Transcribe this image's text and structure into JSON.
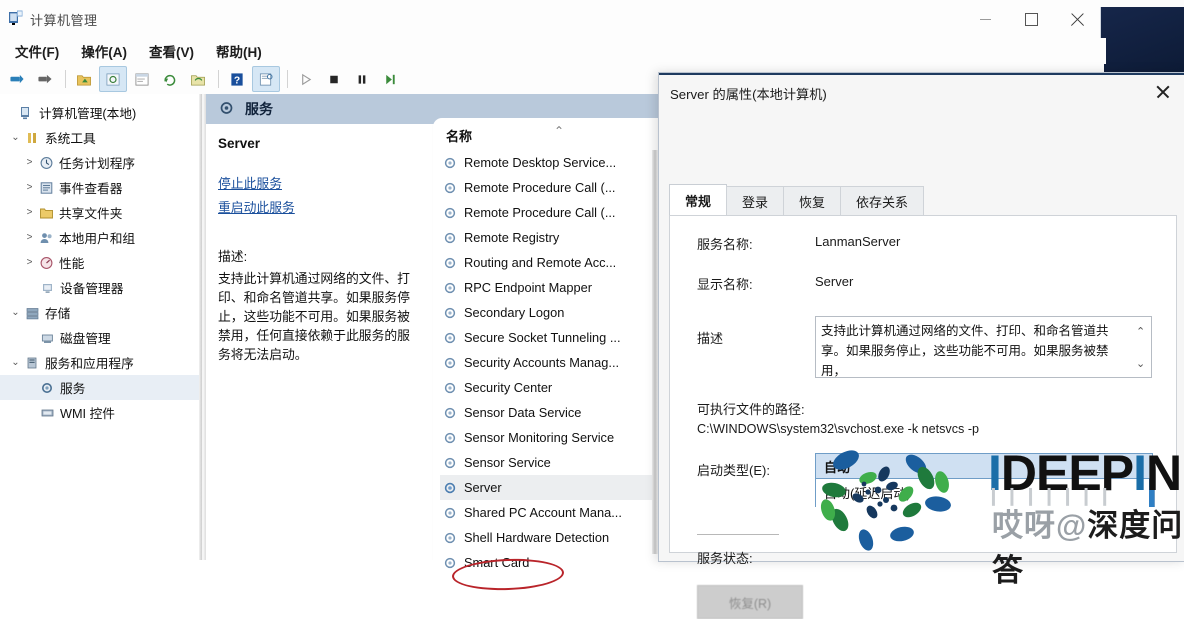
{
  "window": {
    "title": "计算机管理",
    "icon": "computer-management-icon",
    "minimize_label": "最小化",
    "maximize_label": "最大化",
    "close_label": "关闭"
  },
  "menu": [
    {
      "label": "文件(F)"
    },
    {
      "label": "操作(A)"
    },
    {
      "label": "查看(V)"
    },
    {
      "label": "帮助(H)"
    }
  ],
  "toolbar": [
    {
      "name": "back-icon",
      "glyph": "◀"
    },
    {
      "name": "forward-icon",
      "glyph": "➡"
    },
    {
      "name": "up-folder-icon",
      "glyph": "📁"
    },
    {
      "name": "show-hide-tree-icon",
      "glyph": "🗔"
    },
    {
      "name": "properties-window-icon",
      "glyph": "▤"
    },
    {
      "name": "refresh-icon",
      "glyph": "↻"
    },
    {
      "name": "export-list-icon",
      "glyph": "🖫"
    },
    {
      "name": "help-icon",
      "glyph": "?"
    },
    {
      "name": "properties-icon",
      "glyph": "▥"
    },
    {
      "name": "start-service-icon",
      "glyph": "▶"
    },
    {
      "name": "stop-service-icon",
      "glyph": "■"
    },
    {
      "name": "pause-service-icon",
      "glyph": "❚❚"
    },
    {
      "name": "restart-service-icon",
      "glyph": "⏭"
    }
  ],
  "tree": [
    {
      "label": "计算机管理(本地)",
      "indent": 0,
      "expander": "",
      "icon": "computer-icon",
      "selected": false
    },
    {
      "label": "系统工具",
      "indent": 1,
      "expander": "v",
      "icon": "tools-icon",
      "selected": false
    },
    {
      "label": "任务计划程序",
      "indent": 2,
      "expander": ">",
      "icon": "clock-icon",
      "selected": false
    },
    {
      "label": "事件查看器",
      "indent": 2,
      "expander": ">",
      "icon": "event-icon",
      "selected": false
    },
    {
      "label": "共享文件夹",
      "indent": 2,
      "expander": ">",
      "icon": "shared-folder-icon",
      "selected": false
    },
    {
      "label": "本地用户和组",
      "indent": 2,
      "expander": ">",
      "icon": "users-icon",
      "selected": false
    },
    {
      "label": "性能",
      "indent": 2,
      "expander": ">",
      "icon": "performance-icon",
      "selected": false
    },
    {
      "label": "设备管理器",
      "indent": 2,
      "expander": "",
      "icon": "device-manager-icon",
      "selected": false
    },
    {
      "label": "存储",
      "indent": 1,
      "expander": "v",
      "icon": "storage-icon",
      "selected": false
    },
    {
      "label": "磁盘管理",
      "indent": 2,
      "expander": "",
      "icon": "disk-icon",
      "selected": false
    },
    {
      "label": "服务和应用程序",
      "indent": 1,
      "expander": "v",
      "icon": "services-apps-icon",
      "selected": false
    },
    {
      "label": "服务",
      "indent": 2,
      "expander": "",
      "icon": "service-gear-icon",
      "selected": true
    },
    {
      "label": "WMI 控件",
      "indent": 2,
      "expander": "",
      "icon": "wmi-icon",
      "selected": false
    }
  ],
  "pane": {
    "header_title": "服务",
    "header_icon": "service-gear-icon",
    "service_name": "Server",
    "links": [
      {
        "label": "停止此服务",
        "highlight": "停止"
      },
      {
        "label": "重启动此服务",
        "highlight": "重启动"
      }
    ],
    "description_label": "描述:",
    "description_text": "支持此计算机通过网络的文件、打印、和命名管道共享。如果服务停止，这些功能不可用。如果服务被禁用，任何直接依赖于此服务的服务将无法启动。"
  },
  "list": {
    "column_header": "名称",
    "sort_arrow": "⌃",
    "rows": [
      {
        "label": "Remote Desktop Service...",
        "selected": false
      },
      {
        "label": "Remote Procedure Call (...",
        "selected": false
      },
      {
        "label": "Remote Procedure Call (...",
        "selected": false
      },
      {
        "label": "Remote Registry",
        "selected": false
      },
      {
        "label": "Routing and Remote Acc...",
        "selected": false
      },
      {
        "label": "RPC Endpoint Mapper",
        "selected": false
      },
      {
        "label": "Secondary Logon",
        "selected": false
      },
      {
        "label": "Secure Socket Tunneling ...",
        "selected": false
      },
      {
        "label": "Security Accounts Manag...",
        "selected": false
      },
      {
        "label": "Security Center",
        "selected": false
      },
      {
        "label": "Sensor Data Service",
        "selected": false
      },
      {
        "label": "Sensor Monitoring Service",
        "selected": false
      },
      {
        "label": "Sensor Service",
        "selected": false
      },
      {
        "label": "Server",
        "selected": true
      },
      {
        "label": "Shared PC Account Mana...",
        "selected": false
      },
      {
        "label": "Shell Hardware Detection",
        "selected": false
      },
      {
        "label": "Smart Card",
        "selected": false
      }
    ],
    "annotation_color": "#b9242a"
  },
  "dialog": {
    "title": "Server 的属性(本地计算机)",
    "close_label": "关闭",
    "tabs": [
      {
        "label": "常规",
        "active": true
      },
      {
        "label": "登录",
        "active": false
      },
      {
        "label": "恢复",
        "active": false
      },
      {
        "label": "依存关系",
        "active": false
      }
    ],
    "fields": {
      "service_name_label": "服务名称:",
      "service_name_value": "LanmanServer",
      "display_name_label": "显示名称:",
      "display_name_value": "Server",
      "description_label": "描述",
      "description_value": "支持此计算机通过网络的文件、打印、和命名管道共享。如果服务停止，这些功能不可用。如果服务被禁用，",
      "scroll_up": "⌃",
      "scroll_down": "⌄",
      "path_label": "可执行文件的路径:",
      "path_value": "C:\\WINDOWS\\system32\\svchost.exe -k netsvcs -p",
      "startup_label": "启动类型(E):",
      "startup_value": "自动",
      "startup_options": [
        "自动(延迟启动)"
      ],
      "dropdown_chevron": "⌄",
      "status_label": "服务状态:",
      "action_button_label": "恢复(R)"
    }
  },
  "watermark": {
    "brand_prefix": "I",
    "brand_mid": "DEEP",
    "brand_i": "I",
    "brand_suffix": "N",
    "sub_text": "深度问答",
    "sub_prefix": "哎呀@",
    "logo_name": "deepin-spiral-logo"
  }
}
